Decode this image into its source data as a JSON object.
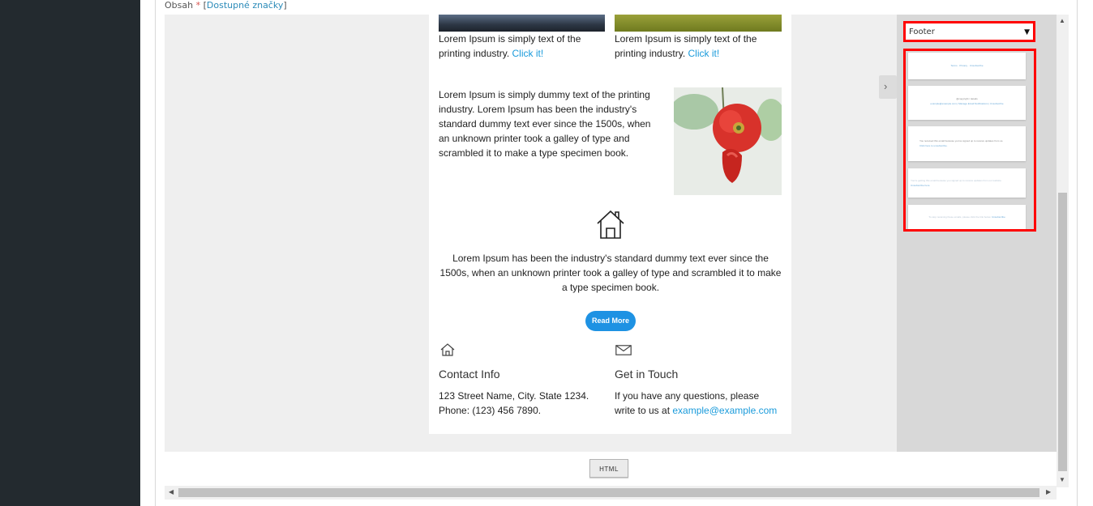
{
  "field": {
    "label": "Obsah",
    "required_mark": "*",
    "tags_link": "Dostupné značky"
  },
  "email": {
    "captions": [
      {
        "text": "Lorem Ipsum is simply text of the printing industry.",
        "link": "Click it!"
      },
      {
        "text": "Lorem Ipsum is simply text of the printing industry.",
        "link": "Click it!"
      }
    ],
    "paragraph": "Lorem Ipsum is simply dummy text of the printing industry. Lorem Ipsum has been the industry's standard dummy text ever since the 1500s, when an unknown printer took a galley of type and scrambled it to make a type specimen book.",
    "center_text": "Lorem Ipsum has been the industry's standard dummy text ever since the 1500s, when an unknown printer took a galley of type and scrambled it to make a type specimen book.",
    "button_label": "Read More",
    "contact": {
      "title": "Contact Info",
      "line1": "123 Street Name, City. State 1234.",
      "line2": "Phone: (123) 456 7890."
    },
    "touch": {
      "title": "Get in Touch",
      "line1": "If you have any questions, please",
      "line2_prefix": "write to us at",
      "email": "example@example.com"
    }
  },
  "panel": {
    "select_value": "Footer",
    "thumbnails": [
      {
        "text": "Terms · Privacy · Unsubscribe"
      },
      {
        "text": "@copyright / details",
        "link": "example@example.com | Manage Email Notifications | Unsubscribe"
      },
      {
        "text": "You received this email because you've signed up to receive updates from us.",
        "link": "Click here to unsubscribe."
      },
      {
        "text": "You're getting this email because you signed up to receive updates from our website.",
        "link": "Unsubscribe here"
      },
      {
        "text": "To stop receiving these emails, please click the link below.",
        "link": "Unsubscribe"
      }
    ]
  },
  "toolbar": {
    "html_button": "HTML"
  },
  "colors": {
    "sidebar": "#232a2f",
    "link": "#1a9bdb",
    "button": "#1e92e3",
    "highlight": "#ff0000"
  }
}
